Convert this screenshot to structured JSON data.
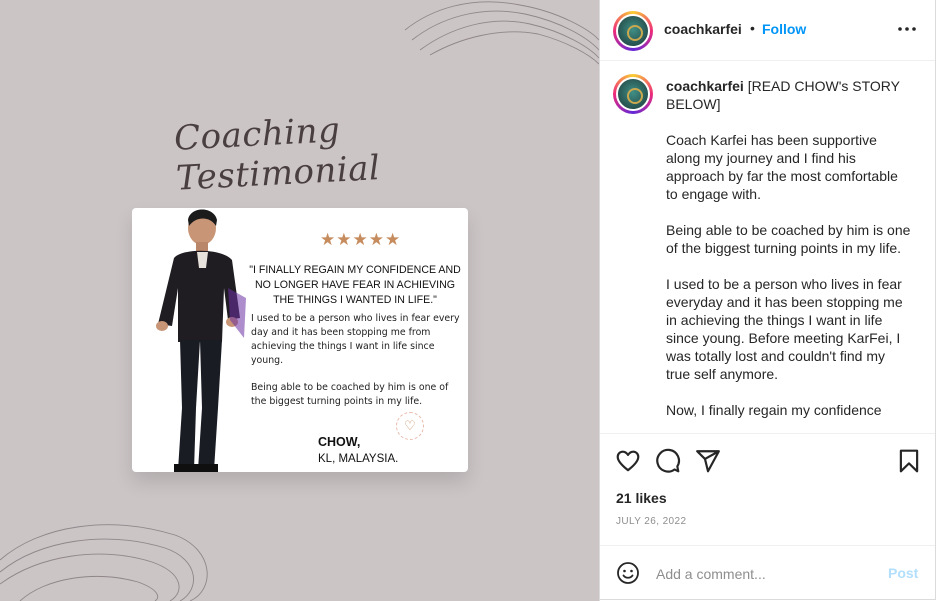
{
  "post_image": {
    "script_title": "Coaching Testimonial",
    "stars": "★★★★★",
    "quote": "\"I FINALLY REGAIN MY CONFIDENCE AND NO LONGER HAVE FEAR IN ACHIEVING THE THINGS I WANTED IN LIFE.\"",
    "body_paragraph_1": "I used to be a person who lives in fear every day and it has been stopping me from achieving the things I want in life since young.",
    "body_paragraph_2": "Being able to be coached by him is one of the biggest turning points in my life.",
    "author_name": "CHOW,",
    "author_location": "KL, MALAYSIA."
  },
  "header": {
    "username": "coachkarfei",
    "separator": "•",
    "follow_label": "Follow",
    "more_icon": "more-horizontal-icon"
  },
  "caption": {
    "username": "coachkarfei",
    "first_line": "[READ CHOW's STORY BELOW]",
    "paragraphs": [
      "Coach Karfei has been supportive along my journey and I find his approach by far the most comfortable to engage with.",
      "Being able to be coached by him is one of the biggest turning points in my life.",
      "I used to be a person who lives in fear everyday and it has been stopping me in achieving the things I want in life since young. Before meeting KarFei, I was totally lost and couldn't find my true self anymore.",
      "Now, I finally regain my confidence"
    ]
  },
  "actions": {
    "icons": [
      "heart-icon",
      "comment-icon",
      "share-icon",
      "bookmark-icon"
    ]
  },
  "likes": "21 likes",
  "date": "JULY 26, 2022",
  "comment_box": {
    "placeholder": "Add a comment...",
    "post_label": "Post"
  },
  "colors": {
    "image_background": "#cbc5c6",
    "accent_link": "#0095f6",
    "star_color": "#c68c5d"
  }
}
